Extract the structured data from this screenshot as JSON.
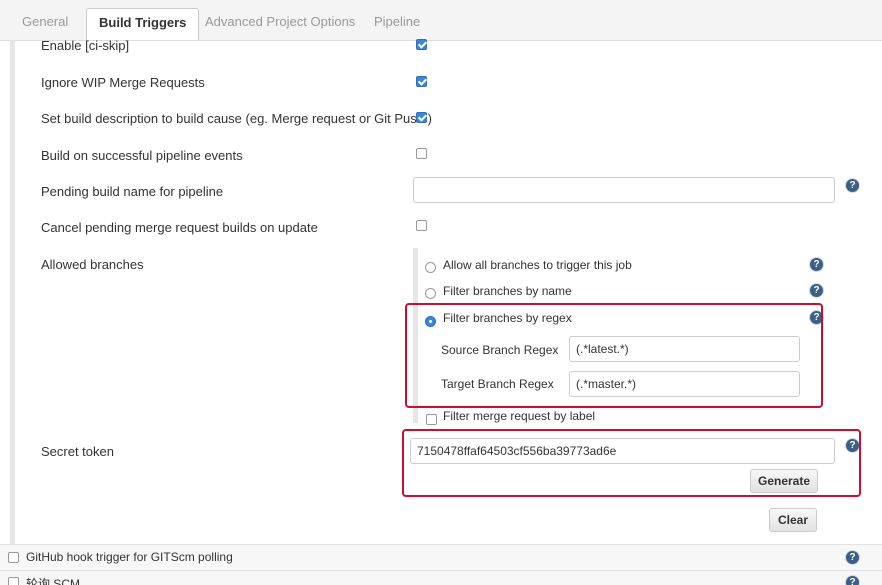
{
  "tabs": [
    "General",
    "Build Triggers",
    "Advanced Project Options",
    "Pipeline"
  ],
  "active_tab": "Build Triggers",
  "options": [
    {
      "label": "Enable [ci-skip]",
      "checked": true
    },
    {
      "label": "Ignore WIP Merge Requests",
      "checked": true
    },
    {
      "label": "Set build description to build cause (eg. Merge request or Git Push )",
      "checked": true
    },
    {
      "label": "Build on successful pipeline events",
      "checked": false
    },
    {
      "label": "Pending build name for pipeline",
      "value": ""
    },
    {
      "label": "Cancel pending merge request builds on update",
      "checked": false
    }
  ],
  "allowed_branches": {
    "label": "Allowed branches",
    "options": [
      {
        "label": "Allow all branches to trigger this job",
        "selected": false
      },
      {
        "label": "Filter branches by name",
        "selected": false
      },
      {
        "label": "Filter branches by regex",
        "selected": true
      },
      {
        "label": "Filter merge request by label",
        "selected": false
      }
    ],
    "source_label": "Source Branch Regex",
    "source_value": "(.*latest.*)",
    "target_label": "Target Branch Regex",
    "target_value": "(.*master.*)"
  },
  "secret_token": {
    "label": "Secret token",
    "value": "7150478ffaf64503cf556ba39773ad6e",
    "generate_label": "Generate",
    "clear_label": "Clear"
  },
  "bottom": [
    {
      "label": "GitHub hook trigger for GITScm polling",
      "checked": false
    },
    {
      "label": "轮询 SCM",
      "checked": false
    }
  ],
  "help_glyph": "?",
  "colors": {
    "highlight": "#c8102e",
    "accent": "#3a87d8",
    "help": "#3b5f86"
  }
}
